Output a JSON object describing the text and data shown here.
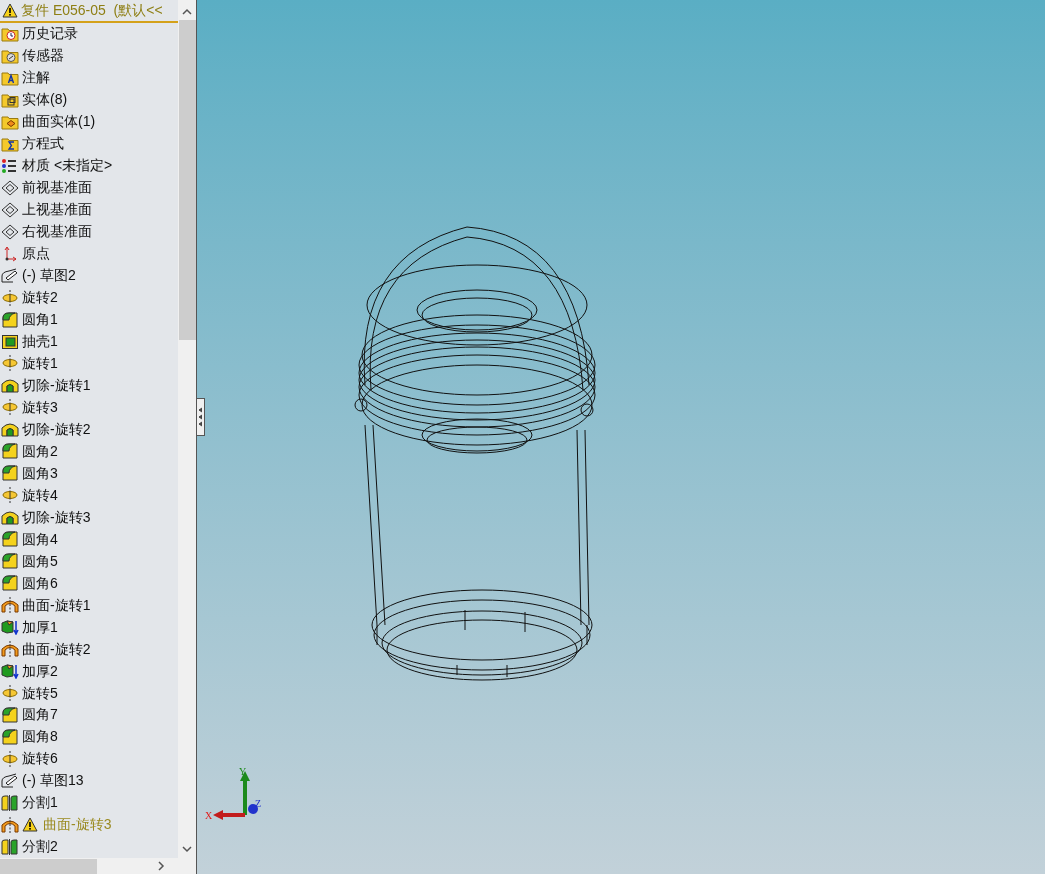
{
  "header": {
    "title": "复件 E056-05  (默认<<",
    "warning": true
  },
  "tree": [
    {
      "label": "历史记录",
      "kind": "folder-history",
      "warning": false
    },
    {
      "label": "传感器",
      "kind": "folder-sensor",
      "warning": false
    },
    {
      "label": "注解",
      "kind": "folder-annotation",
      "warning": false
    },
    {
      "label": "实体(8)",
      "kind": "folder-solid",
      "warning": false
    },
    {
      "label": "曲面实体(1)",
      "kind": "folder-surface",
      "warning": false
    },
    {
      "label": "方程式",
      "kind": "folder-equation",
      "warning": false
    },
    {
      "label": "材质 <未指定>",
      "kind": "material",
      "warning": false
    },
    {
      "label": "前视基准面",
      "kind": "plane",
      "warning": false
    },
    {
      "label": "上视基准面",
      "kind": "plane",
      "warning": false
    },
    {
      "label": "右视基准面",
      "kind": "plane",
      "warning": false
    },
    {
      "label": "原点",
      "kind": "origin",
      "warning": false
    },
    {
      "label": "(-) 草图2",
      "kind": "sketch",
      "warning": false
    },
    {
      "label": "旋转2",
      "kind": "revolve",
      "warning": false
    },
    {
      "label": "圆角1",
      "kind": "fillet",
      "warning": false
    },
    {
      "label": "抽壳1",
      "kind": "shell",
      "warning": false
    },
    {
      "label": "旋转1",
      "kind": "revolve",
      "warning": false
    },
    {
      "label": "切除-旋转1",
      "kind": "cut",
      "warning": false
    },
    {
      "label": "旋转3",
      "kind": "revolve",
      "warning": false
    },
    {
      "label": "切除-旋转2",
      "kind": "cut",
      "warning": false
    },
    {
      "label": "圆角2",
      "kind": "fillet",
      "warning": false
    },
    {
      "label": "圆角3",
      "kind": "fillet",
      "warning": false
    },
    {
      "label": "旋转4",
      "kind": "revolve",
      "warning": false
    },
    {
      "label": "切除-旋转3",
      "kind": "cut",
      "warning": false
    },
    {
      "label": "圆角4",
      "kind": "fillet",
      "warning": false
    },
    {
      "label": "圆角5",
      "kind": "fillet",
      "warning": false
    },
    {
      "label": "圆角6",
      "kind": "fillet",
      "warning": false
    },
    {
      "label": "曲面-旋转1",
      "kind": "surface",
      "warning": false
    },
    {
      "label": "加厚1",
      "kind": "thicken",
      "warning": false
    },
    {
      "label": "曲面-旋转2",
      "kind": "surface",
      "warning": false
    },
    {
      "label": "加厚2",
      "kind": "thicken",
      "warning": false
    },
    {
      "label": "旋转5",
      "kind": "revolve",
      "warning": false
    },
    {
      "label": "圆角7",
      "kind": "fillet",
      "warning": false
    },
    {
      "label": "圆角8",
      "kind": "fillet",
      "warning": false
    },
    {
      "label": "旋转6",
      "kind": "revolve",
      "warning": false
    },
    {
      "label": "(-) 草图13",
      "kind": "sketch",
      "warning": false
    },
    {
      "label": "分割1",
      "kind": "split",
      "warning": false
    },
    {
      "label": "曲面-旋转3",
      "kind": "surface",
      "warning": true
    },
    {
      "label": "分割2",
      "kind": "split",
      "warning": false
    }
  ],
  "triad": {
    "x": "X",
    "y": "Y",
    "z": "Z"
  }
}
